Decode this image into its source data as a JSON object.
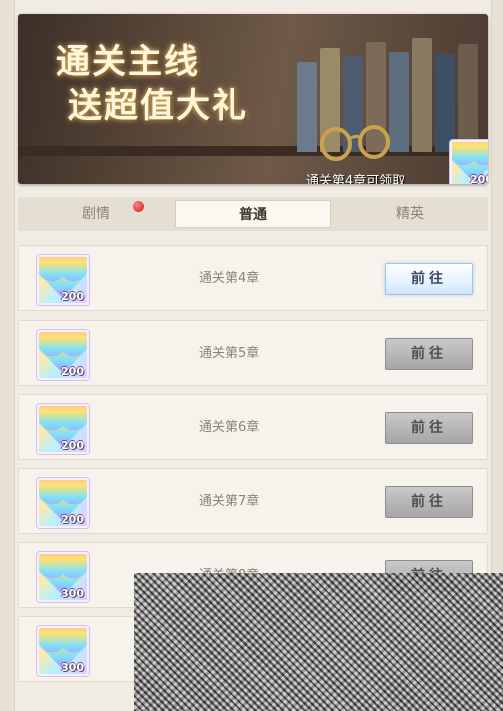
{
  "banner": {
    "title_line1": "通关主线",
    "title_line2": "送超值大礼",
    "note": "通关第4章可领取",
    "reward_qty": "200"
  },
  "tabs": [
    {
      "label": "剧情",
      "has_badge": true
    },
    {
      "label": "普通",
      "active": true
    },
    {
      "label": "精英"
    }
  ],
  "rows": [
    {
      "qty": "200",
      "label": "通关第4章",
      "button": "前往",
      "enabled": true
    },
    {
      "qty": "200",
      "label": "通关第5章",
      "button": "前往",
      "enabled": false
    },
    {
      "qty": "200",
      "label": "通关第6章",
      "button": "前往",
      "enabled": false
    },
    {
      "qty": "200",
      "label": "通关第7章",
      "button": "前往",
      "enabled": false
    },
    {
      "qty": "300",
      "label": "通关第8章",
      "button": "前往",
      "enabled": false
    },
    {
      "qty": "300",
      "label": "",
      "button": "",
      "enabled": false
    }
  ],
  "colors": {
    "active_button": "#e8f3ff",
    "disabled_button": "#a6a6a6",
    "badge": "#d31a1a"
  },
  "icons": {
    "reward": "rainbow-heart-gem-icon",
    "badge": "red-dot-icon"
  }
}
